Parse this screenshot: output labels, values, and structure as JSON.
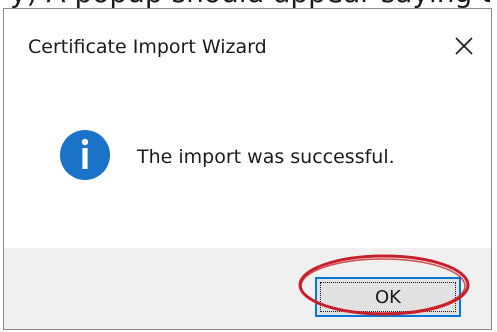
{
  "background": {
    "text": "y) A popup should appear saying the import"
  },
  "dialog": {
    "title": "Certificate Import Wizard",
    "message": "The import was successful.",
    "ok_label": "OK",
    "icon": "info-icon"
  },
  "colors": {
    "info_icon": "#1a73c8",
    "button_border": "#0078d7",
    "footer_bg": "#f0f0f0",
    "annotation": "#c8202a"
  }
}
